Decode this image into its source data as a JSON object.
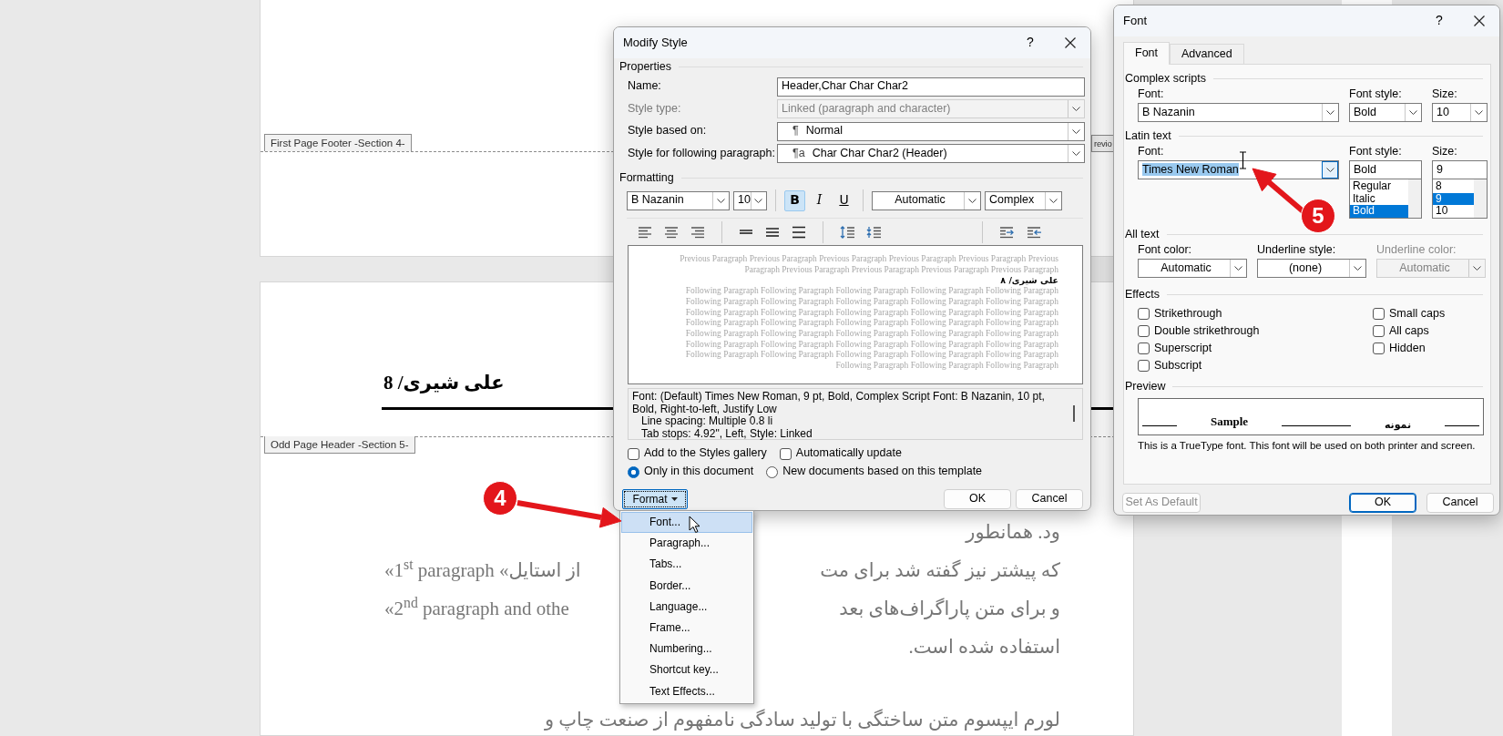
{
  "document": {
    "section_labels": [
      {
        "label": "First Page Footer -Section 4-"
      },
      {
        "label": "Odd Page Header -Section 5-"
      }
    ],
    "cut_label": "revio",
    "header_text": "علی شیری/ 8",
    "body_lines": [
      {
        "right": "ود. همانطور"
      },
      {
        "left": "«1$^{st}$ paragraph «از استایل",
        "right": "که پیشتر نیز گفته شد برای مت"
      },
      {
        "left": "«2$^{nd}$ paragraph and othe",
        "right": "و برای متن پاراگراف‌های بعد"
      },
      {
        "right": "استفاده شده است."
      },
      {
        "right": "لورم ایپسوم متن ساختگی با تولید سادگی نامفهوم از صنعت چاپ و"
      }
    ]
  },
  "modify_style": {
    "title": "Modify Style",
    "help_label": "?",
    "properties_heading": "Properties",
    "fields": [
      {
        "label": "Name:",
        "kind": "text",
        "value": "Header,Char Char Char2",
        "disabled": false
      },
      {
        "label": "Style type:",
        "kind": "select",
        "value": "Linked (paragraph and character)",
        "disabled": true
      },
      {
        "label": "Style based on:",
        "kind": "select",
        "marker": "¶",
        "value": "Normal",
        "disabled": false
      },
      {
        "label": "Style for following paragraph:",
        "kind": "select",
        "marker": "¶a",
        "value": "Char Char Char2  (Header)",
        "disabled": false
      }
    ],
    "formatting_heading": "Formatting",
    "font": "B Nazanin",
    "size": "10",
    "toggles": [
      {
        "label": "B",
        "selected": true
      },
      {
        "label": "I",
        "selected": false
      },
      {
        "label": "U",
        "selected": false
      }
    ],
    "color_option": "Automatic",
    "script": "Complex",
    "preview": {
      "previous_lines": [
        "Previous Paragraph Previous Paragraph Previous Paragraph Previous Paragraph Previous Paragraph Previous",
        "Paragraph Previous Paragraph Previous Paragraph Previous Paragraph Previous Paragraph"
      ],
      "current_line": "علی شیری/ ۸",
      "following_lines": [
        "Following Paragraph Following Paragraph Following Paragraph Following Paragraph Following Paragraph",
        "Following Paragraph Following Paragraph Following Paragraph Following Paragraph Following Paragraph",
        "Following Paragraph Following Paragraph Following Paragraph Following Paragraph Following Paragraph",
        "Following Paragraph Following Paragraph Following Paragraph Following Paragraph Following Paragraph",
        "Following Paragraph Following Paragraph Following Paragraph Following Paragraph Following Paragraph",
        "Following Paragraph Following Paragraph Following Paragraph Following Paragraph Following Paragraph",
        "Following Paragraph Following Paragraph Following Paragraph Following Paragraph Following Paragraph",
        "Following Paragraph Following Paragraph Following Paragraph"
      ]
    },
    "description": {
      "summary": "Font: (Default) Times New Roman, 9 pt, Bold, Complex Script Font: B Nazanin, 10 pt, Bold, Right-to-left, Justify Low",
      "details": [
        "Line spacing:  Multiple 0.8 li",
        "Tab stops:  4.92\", Left, Style: Linked"
      ]
    },
    "checkboxes": [
      {
        "label": "Add to the Styles gallery",
        "checked": false
      },
      {
        "label": "Automatically update",
        "checked": false
      }
    ],
    "radios": [
      {
        "label": "Only in this document",
        "selected": true
      },
      {
        "label": "New documents based on this template",
        "selected": false
      }
    ],
    "format_button": "Format",
    "ok": "OK",
    "cancel": "Cancel"
  },
  "format_menu": {
    "items": [
      {
        "label": "Font...",
        "selected": true
      },
      {
        "label": "Paragraph...",
        "selected": false
      },
      {
        "label": "Tabs...",
        "selected": false
      },
      {
        "label": "Border...",
        "selected": false
      },
      {
        "label": "Language...",
        "selected": false
      },
      {
        "label": "Frame...",
        "selected": false
      },
      {
        "label": "Numbering...",
        "selected": false
      },
      {
        "label": "Shortcut key...",
        "selected": false
      },
      {
        "label": "Text Effects...",
        "selected": false
      }
    ]
  },
  "font_dialog": {
    "title": "Font",
    "help_label": "?",
    "tabs": [
      {
        "label": "Font",
        "selected": true
      },
      {
        "label": "Advanced",
        "selected": false
      }
    ],
    "complex": {
      "heading": "Complex scripts",
      "font_label": "Font:",
      "font": "B Nazanin",
      "style_label": "Font style:",
      "style": "Bold",
      "size_label": "Size:",
      "size": "10"
    },
    "latin": {
      "heading": "Latin text",
      "font_label": "Font:",
      "font": "Times New Roman",
      "font_text_selected": true,
      "style_label": "Font style:",
      "style": "Bold",
      "style_options": [
        {
          "label": "Regular",
          "selected": false
        },
        {
          "label": "Italic",
          "selected": false
        },
        {
          "label": "Bold",
          "selected": true
        }
      ],
      "size_label": "Size:",
      "size": "9",
      "size_options": [
        {
          "label": "8",
          "selected": false
        },
        {
          "label": "9",
          "selected": true
        },
        {
          "label": "10",
          "selected": false
        }
      ]
    },
    "all_text": {
      "heading": "All text",
      "dropdowns": [
        {
          "label": "Font color:",
          "value": "Automatic",
          "disabled": false
        },
        {
          "label": "Underline style:",
          "value": "(none)",
          "disabled": false
        },
        {
          "label": "Underline color:",
          "value": "Automatic",
          "disabled": true
        }
      ]
    },
    "effects": {
      "heading": "Effects",
      "left": [
        {
          "label": "Strikethrough",
          "checked": false
        },
        {
          "label": "Double strikethrough",
          "checked": false
        },
        {
          "label": "Superscript",
          "checked": false
        },
        {
          "label": "Subscript",
          "checked": false
        }
      ],
      "right": [
        {
          "label": "Small caps",
          "checked": false
        },
        {
          "label": "All caps",
          "checked": false
        },
        {
          "label": "Hidden",
          "checked": false
        }
      ]
    },
    "preview": {
      "heading": "Preview",
      "latin_sample": "Sample",
      "complex_sample": "نمونه",
      "note": "This is a TrueType font. This font will be used on both printer and screen."
    },
    "buttons": [
      {
        "label": "Set As Default",
        "disabled": true,
        "default": false
      },
      {
        "label": "OK",
        "disabled": false,
        "default": true
      },
      {
        "label": "Cancel",
        "disabled": false,
        "default": false
      }
    ]
  },
  "annotations": [
    {
      "number": "4"
    },
    {
      "number": "5"
    }
  ]
}
